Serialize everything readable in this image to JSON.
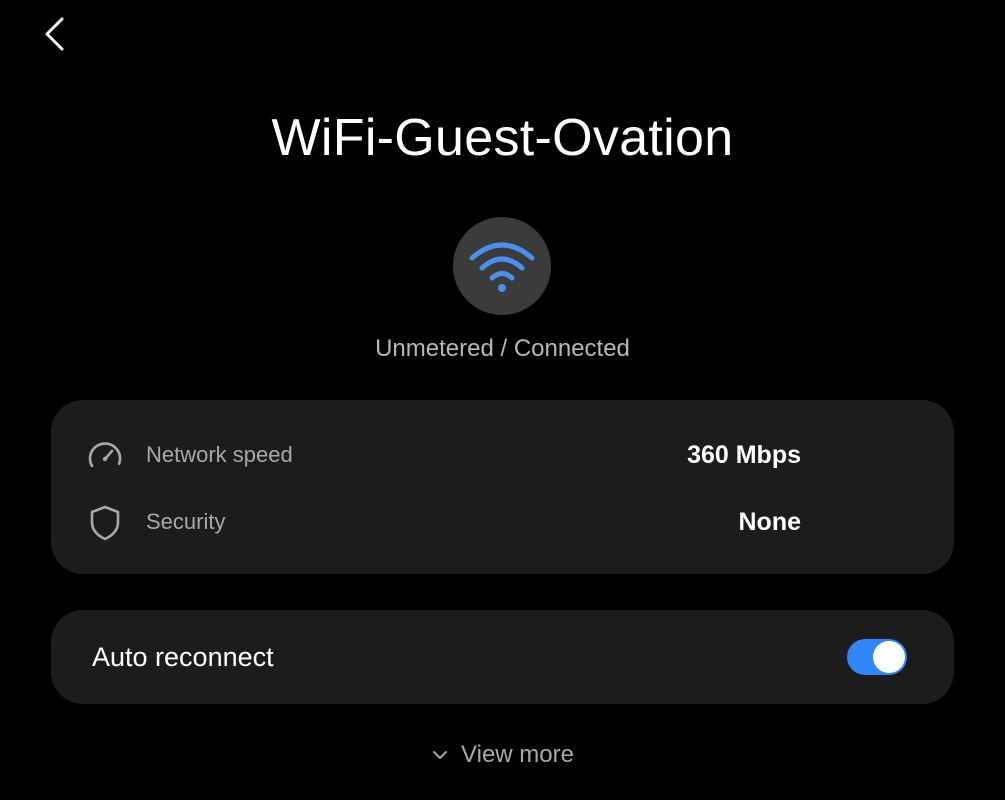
{
  "header": {
    "back_icon": "chevron-left-icon",
    "title": "WiFi-Guest-Ovation"
  },
  "network": {
    "icon": "wifi-icon",
    "status": "Unmetered / Connected"
  },
  "details": [
    {
      "icon": "speedometer-icon",
      "label": "Network speed",
      "value": "360 Mbps"
    },
    {
      "icon": "shield-icon",
      "label": "Security",
      "value": "None"
    }
  ],
  "auto_reconnect": {
    "label": "Auto reconnect",
    "enabled": true
  },
  "view_more": {
    "icon": "chevron-down-icon",
    "label": "View more"
  },
  "colors": {
    "background": "#000000",
    "card": "#1c1c1c",
    "accent": "#2f86f6",
    "wifi_icon": "#4a90f0"
  }
}
